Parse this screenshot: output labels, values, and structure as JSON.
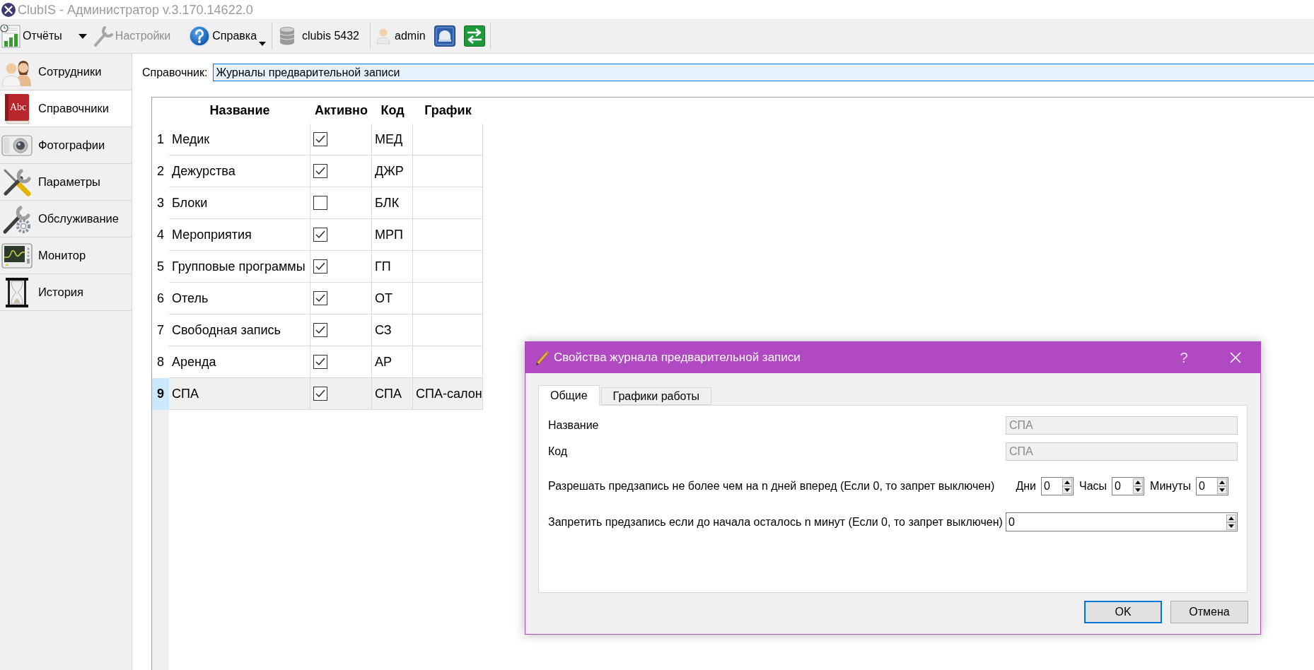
{
  "window": {
    "title": "ClubIS - Администратор v.3.170.14622.0"
  },
  "toolbar": {
    "reports": {
      "label": "Отчёты"
    },
    "settings": {
      "label": "Настройки",
      "disabled": true
    },
    "help": {
      "label": "Справка"
    },
    "database": {
      "label": "clubis 5432"
    },
    "user": {
      "label": "admin"
    }
  },
  "sidebar": {
    "items": [
      {
        "label": "Сотрудники",
        "selected": false
      },
      {
        "label": "Справочники",
        "selected": true,
        "icon_text": "Abc"
      },
      {
        "label": "Фотографии",
        "selected": false
      },
      {
        "label": "Параметры",
        "selected": false
      },
      {
        "label": "Обслуживание",
        "selected": false
      },
      {
        "label": "Монитор",
        "selected": false
      },
      {
        "label": "История",
        "selected": false
      }
    ]
  },
  "directory": {
    "label": "Справочник:",
    "value": "Журналы предварительной записи"
  },
  "table": {
    "columns": [
      "Название",
      "Активно",
      "Код",
      "График"
    ],
    "rows": [
      {
        "number": "1",
        "name": "Медик",
        "active": true,
        "code": "МЕД",
        "selected": false
      },
      {
        "number": "2",
        "name": "Дежурства",
        "active": true,
        "code": "ДЖР",
        "selected": false
      },
      {
        "number": "3",
        "name": "Блоки",
        "active": false,
        "code": "БЛК",
        "selected": false
      },
      {
        "number": "4",
        "name": "Мероприятия",
        "active": true,
        "code": "МРП",
        "selected": false
      },
      {
        "number": "5",
        "name": "Групповые программы",
        "active": true,
        "code": "ГП",
        "selected": false
      },
      {
        "number": "6",
        "name": "Отель",
        "active": true,
        "code": "ОТ",
        "selected": false
      },
      {
        "number": "7",
        "name": "Свободная запись",
        "active": true,
        "code": "СЗ",
        "selected": false
      },
      {
        "number": "8",
        "name": "Аренда",
        "active": true,
        "code": "АР",
        "selected": false
      },
      {
        "number": "9",
        "name": "СПА",
        "active": true,
        "code": "СПА",
        "schedule": "СПА-салон",
        "selected": true
      }
    ]
  },
  "dialog": {
    "title": "Свойства журнала предварительной записи",
    "help": "?",
    "tabs": [
      {
        "label": "Общие",
        "selected": true
      },
      {
        "label": "Графики работы",
        "selected": false
      }
    ],
    "fields": [
      {
        "label": "Название",
        "value": "СПА",
        "disabled": true
      },
      {
        "label": "Код",
        "value": "СПА",
        "disabled": true
      }
    ],
    "advance_limit": {
      "label": "Разрешать предзапись не более чем на n дней вперед (Если 0, то запрет выключен)",
      "spins": [
        {
          "label": "Дни",
          "value": "0"
        },
        {
          "label": "Часы",
          "value": "0"
        },
        {
          "label": "Минуты",
          "value": "0"
        }
      ]
    },
    "lead_time": {
      "label": "Запретить предзапись если до начала осталось n минут (Если 0, то запрет выключен)",
      "value": "0"
    },
    "buttons": [
      {
        "label": "OK",
        "default": true
      },
      {
        "label": "Отмена",
        "default": false
      }
    ]
  }
}
